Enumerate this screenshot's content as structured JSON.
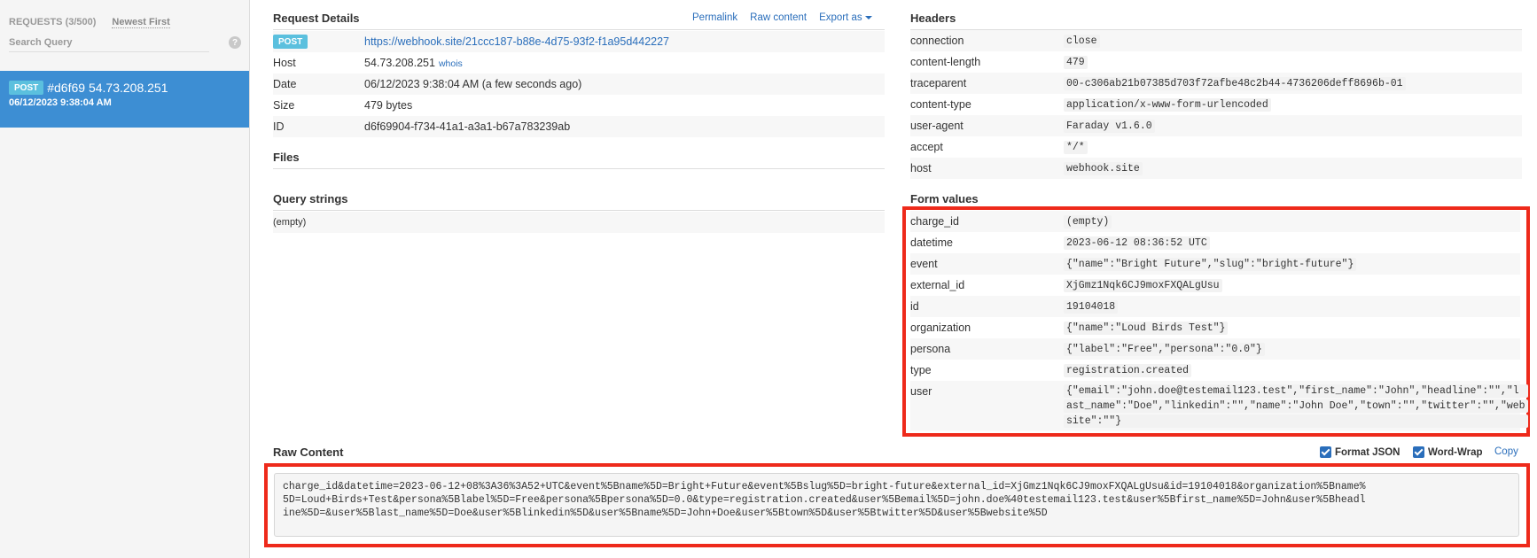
{
  "sidebar": {
    "requests_count": "REQUESTS (3/500)",
    "sort_label": "Newest First",
    "search_placeholder": "Search Query",
    "help_glyph": "?",
    "selected_request": {
      "method": "POST",
      "id_ip": "#d6f69 54.73.208.251",
      "timestamp": "06/12/2023 9:38:04 AM"
    }
  },
  "request_details": {
    "title": "Request Details",
    "actions": {
      "permalink": "Permalink",
      "raw_content": "Raw content",
      "export_as": "Export as"
    },
    "method": "POST",
    "url": "https://webhook.site/21ccc187-b88e-4d75-93f2-f1a95d442227",
    "rows": [
      {
        "key": "Host",
        "value": "54.73.208.251",
        "extra": "whois"
      },
      {
        "key": "Date",
        "value": "06/12/2023 9:38:04 AM (a few seconds ago)"
      },
      {
        "key": "Size",
        "value": "479 bytes"
      },
      {
        "key": "ID",
        "value": "d6f69904-f734-41a1-a3a1-b67a783239ab"
      }
    ]
  },
  "files": {
    "title": "Files"
  },
  "query_strings": {
    "title": "Query strings",
    "empty": "(empty)"
  },
  "headers": {
    "title": "Headers",
    "rows": [
      {
        "key": "connection",
        "value": "close"
      },
      {
        "key": "content-length",
        "value": "479"
      },
      {
        "key": "traceparent",
        "value": "00-c306ab21b07385d703f72afbe48c2b44-4736206deff8696b-01"
      },
      {
        "key": "content-type",
        "value": "application/x-www-form-urlencoded"
      },
      {
        "key": "user-agent",
        "value": "Faraday v1.6.0"
      },
      {
        "key": "accept",
        "value": "*/*"
      },
      {
        "key": "host",
        "value": "webhook.site"
      }
    ]
  },
  "form_values": {
    "title": "Form values",
    "rows": [
      {
        "key": "charge_id",
        "value": "(empty)"
      },
      {
        "key": "datetime",
        "value": "2023-06-12 08:36:52 UTC"
      },
      {
        "key": "event",
        "value": "{\"name\":\"Bright Future\",\"slug\":\"bright-future\"}"
      },
      {
        "key": "external_id",
        "value": "XjGmz1Nqk6CJ9moxFXQALgUsu"
      },
      {
        "key": "id",
        "value": "19104018"
      },
      {
        "key": "organization",
        "value": "{\"name\":\"Loud Birds Test\"}"
      },
      {
        "key": "persona",
        "value": "{\"label\":\"Free\",\"persona\":\"0.0\"}"
      },
      {
        "key": "type",
        "value": "registration.created"
      },
      {
        "key": "user",
        "value_lines": [
          "{\"email\":\"john.doe@testemail123.test\",\"first_name\":\"John\",\"headline\":\"\",\"l",
          "ast_name\":\"Doe\",\"linkedin\":\"\",\"name\":\"John Doe\",\"town\":\"\",\"twitter\":\"\",\"web",
          "site\":\"\"}"
        ]
      }
    ]
  },
  "raw_content": {
    "title": "Raw Content",
    "format_json": "Format JSON",
    "word_wrap": "Word-Wrap",
    "copy": "Copy",
    "lines": [
      "charge_id&datetime=2023-06-12+08%3A36%3A52+UTC&event%5Bname%5D=Bright+Future&event%5Bslug%5D=bright-future&external_id=XjGmz1Nqk6CJ9moxFXQALgUsu&id=19104018&organization%5Bname%",
      "5D=Loud+Birds+Test&persona%5Blabel%5D=Free&persona%5Bpersona%5D=0.0&type=registration.created&user%5Bemail%5D=john.doe%40testemail123.test&user%5Bfirst_name%5D=John&user%5Bheadl",
      "ine%5D=&user%5Blast_name%5D=Doe&user%5Blinkedin%5D&user%5Bname%5D=John+Doe&user%5Btown%5D&user%5Btwitter%5D&user%5Bwebsite%5D"
    ]
  },
  "colors": {
    "accent": "#2a6ebb",
    "selected_bg": "#3d8ed3",
    "badge": "#5bc0de",
    "highlight": "#ee2a1b"
  }
}
